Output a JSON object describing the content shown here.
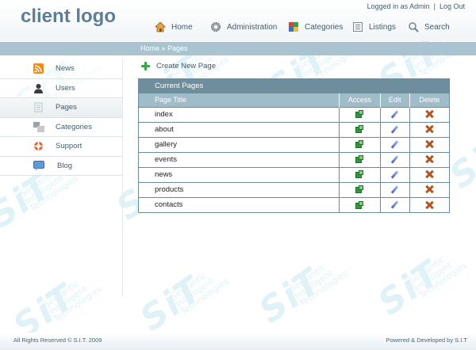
{
  "header": {
    "logo": "client logo",
    "logged_in": "Logged in as Admin",
    "separator": "|",
    "logout": "Log Out"
  },
  "topnav": [
    {
      "label": "Home",
      "icon": "home-icon"
    },
    {
      "label": "Administration",
      "icon": "gear-icon"
    },
    {
      "label": "Categories",
      "icon": "categories-icon"
    },
    {
      "label": "Listings",
      "icon": "listings-icon"
    },
    {
      "label": "Search",
      "icon": "search-icon"
    }
  ],
  "breadcrumb": "Home » Pages",
  "sidebar": {
    "items": [
      {
        "label": "News",
        "icon": "rss-icon"
      },
      {
        "label": "Users",
        "icon": "user-icon"
      },
      {
        "label": "Pages",
        "icon": "page-icon",
        "active": true
      },
      {
        "label": "Categories",
        "icon": "categories-icon"
      },
      {
        "label": "Support",
        "icon": "lifebuoy-icon"
      },
      {
        "label": "Blog",
        "icon": "chat-icon"
      }
    ]
  },
  "main": {
    "create_label": "Create New Page",
    "table_caption": "Current Pages",
    "columns": [
      "Page Title",
      "Access",
      "Edit",
      "Delete"
    ],
    "rows": [
      "index",
      "about",
      "gallery",
      "events",
      "news",
      "products",
      "contacts"
    ]
  },
  "footer": {
    "left": "All Rights Reserved © S.I.T. 2009",
    "right": "Powered & Developed by S.I.T"
  },
  "watermark": {
    "mark": "SiT",
    "line1": "Semantic",
    "line2": "Intelligent",
    "line3": "Technologies"
  },
  "colors": {
    "logo": "#5d7f95",
    "breadcrumb_bar": "#a9c4d0",
    "table_caption": "#6f8e9d",
    "table_header": "#9fbcc9",
    "access_green": "#2f9a3c",
    "delete_orange": "#b5531f"
  }
}
